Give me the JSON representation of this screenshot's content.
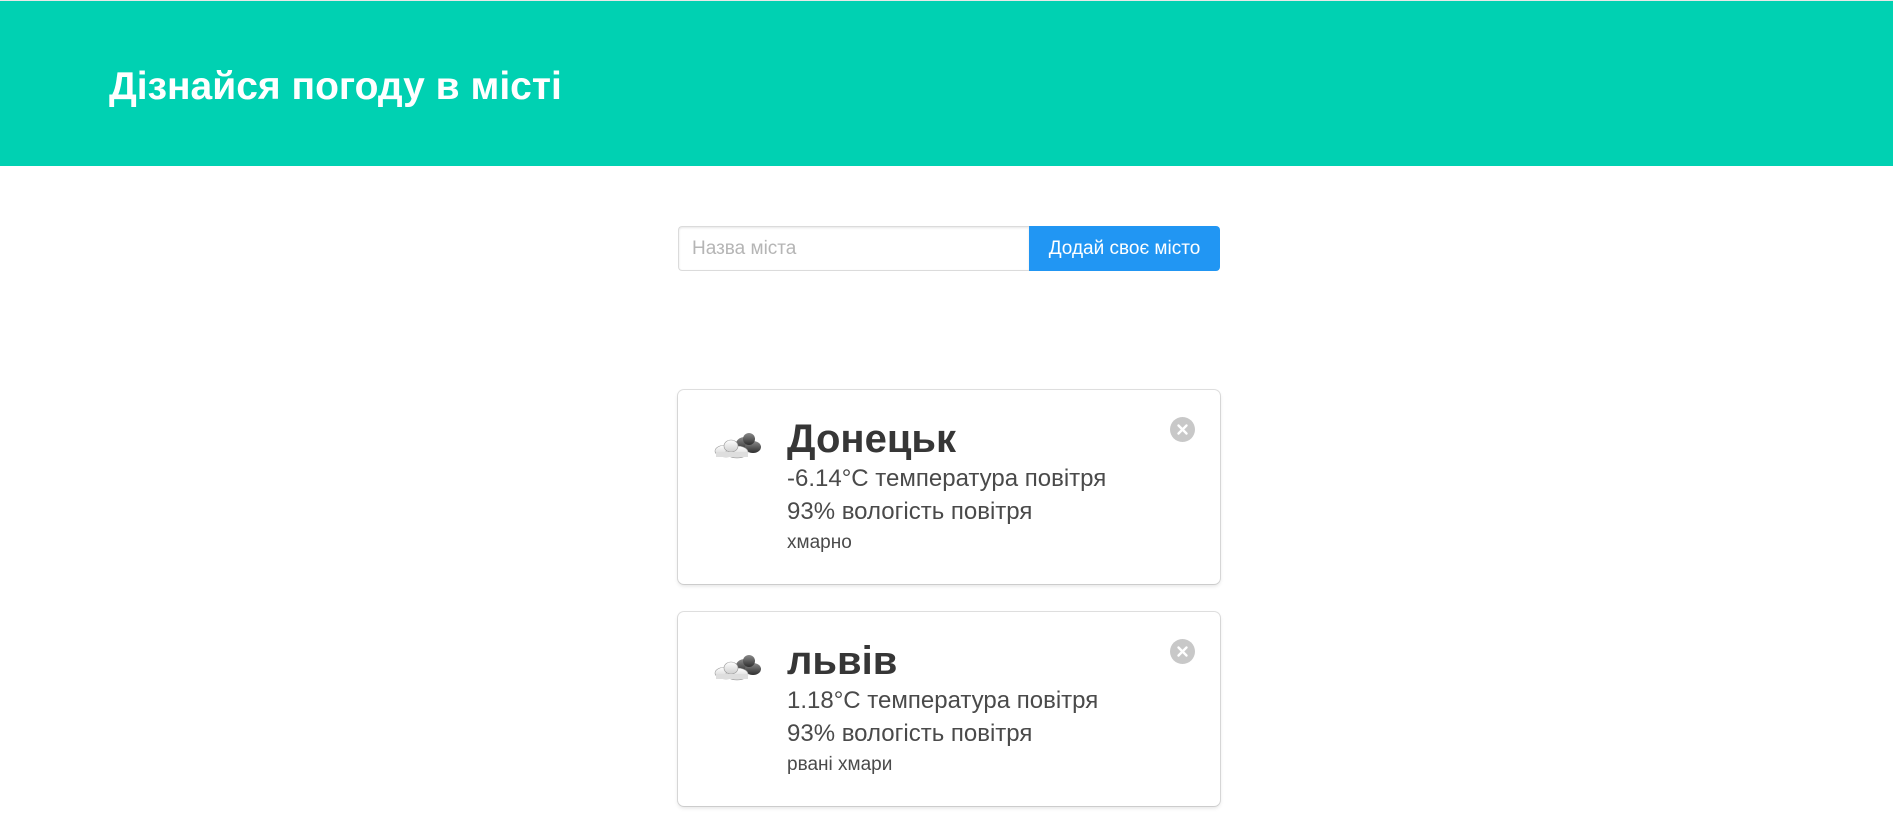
{
  "header": {
    "title": "Дізнайся погоду в місті"
  },
  "search": {
    "placeholder": "Назва міста",
    "value": "",
    "button_label": "Додай своє місто"
  },
  "cities": [
    {
      "name": "Донецьк",
      "temperature": "-6.14°C температура повітря",
      "humidity": "93% вологість повітря",
      "description": "хмарно",
      "icon": "cloudy-icon"
    },
    {
      "name": "львів",
      "temperature": "1.18°C температура повітря",
      "humidity": "93% вологість повітря",
      "description": "рвані хмари",
      "icon": "broken-clouds-icon"
    }
  ],
  "colors": {
    "hero": "#00d1b2",
    "button": "#2196f3",
    "delete": "#c8c8c8"
  }
}
